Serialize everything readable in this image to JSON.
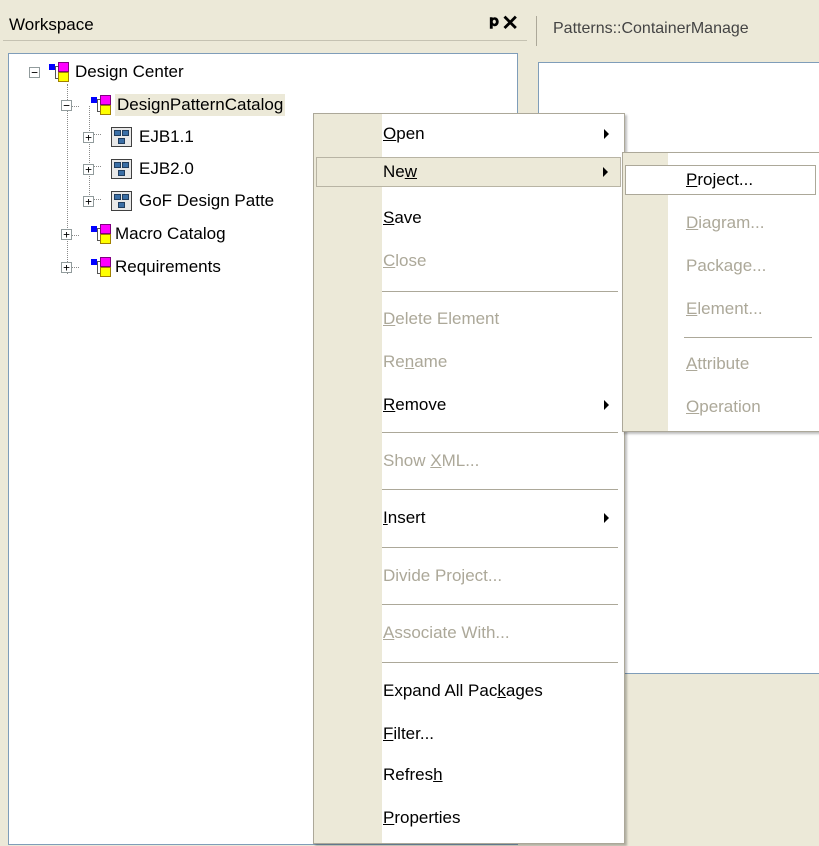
{
  "workspace": {
    "title": "Workspace",
    "pin": "p",
    "close": "✕"
  },
  "tree": [
    {
      "label": "Design Center",
      "expander": "−",
      "icon": "package-icon"
    },
    {
      "label": "DesignPatternCatalog",
      "expander": "−",
      "icon": "package-icon"
    },
    {
      "label": "EJB1.1",
      "expander": "+",
      "icon": "model-icon"
    },
    {
      "label": "EJB2.0",
      "expander": "+",
      "icon": "model-icon"
    },
    {
      "label": "GoF Design Patte",
      "expander": "+",
      "icon": "model-icon"
    },
    {
      "label": "Macro Catalog",
      "expander": "+",
      "icon": "package-icon"
    },
    {
      "label": "Requirements",
      "expander": "+",
      "icon": "package-icon"
    }
  ],
  "doc_tab": {
    "label": "Patterns::ContainerManage"
  },
  "menu": {
    "open": {
      "pre": "",
      "u": "O",
      "post": "pen"
    },
    "new": {
      "pre": "Ne",
      "u": "w",
      "post": ""
    },
    "save": {
      "pre": "",
      "u": "S",
      "post": "ave"
    },
    "close": {
      "pre": "",
      "u": "C",
      "post": "lose"
    },
    "delete_element": {
      "pre": "",
      "u": "D",
      "post": "elete Element"
    },
    "rename": {
      "pre": "Re",
      "u": "n",
      "post": "ame"
    },
    "remove": {
      "pre": "",
      "u": "R",
      "post": "emove"
    },
    "show_xml": {
      "pre": "Show ",
      "u": "X",
      "post": "ML..."
    },
    "insert": {
      "pre": "",
      "u": "I",
      "post": "nsert"
    },
    "divide_project": {
      "pre": "Divide Pro",
      "u": "j",
      "post": "ect..."
    },
    "associate_with": {
      "pre": "",
      "u": "A",
      "post": "ssociate With..."
    },
    "expand_all": {
      "pre": "Expand All Pac",
      "u": "k",
      "post": "ages"
    },
    "filter": {
      "pre": "",
      "u": "F",
      "post": "ilter..."
    },
    "refresh": {
      "pre": "Refres",
      "u": "h",
      "post": ""
    },
    "properties": {
      "pre": "",
      "u": "P",
      "post": "roperties"
    }
  },
  "submenu": {
    "project": {
      "pre": "",
      "u": "P",
      "post": "roject..."
    },
    "diagram": {
      "pre": "",
      "u": "D",
      "post": "iagram..."
    },
    "package": {
      "pre": "Packa",
      "u": "g",
      "post": "e..."
    },
    "element": {
      "pre": "",
      "u": "E",
      "post": "lement..."
    },
    "attribute": {
      "pre": "",
      "u": "A",
      "post": "ttribute"
    },
    "operation": {
      "pre": "",
      "u": "O",
      "post": "peration"
    }
  }
}
